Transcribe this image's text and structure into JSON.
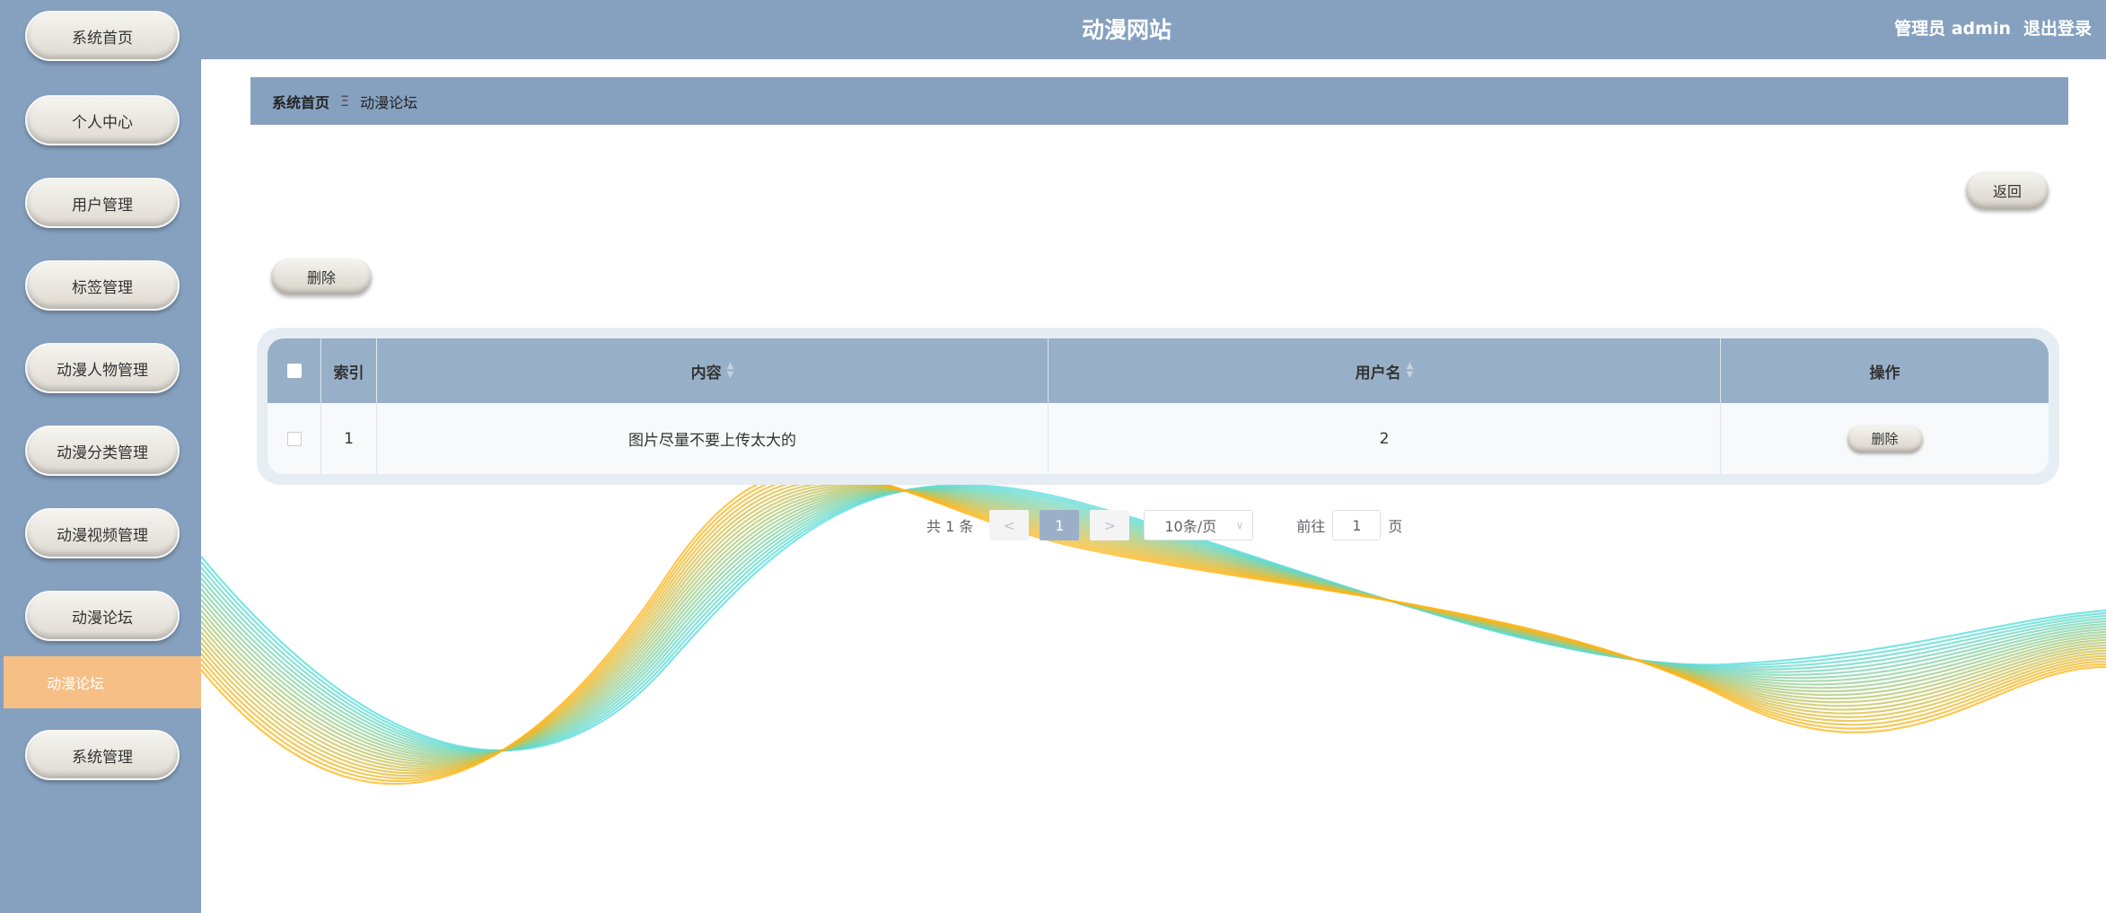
{
  "header": {
    "title": "动漫网站",
    "user_label": "管理员 admin",
    "logout_label": "退出登录"
  },
  "sidebar": {
    "items": [
      {
        "label": "系统首页"
      },
      {
        "label": "个人中心"
      },
      {
        "label": "用户管理"
      },
      {
        "label": "标签管理"
      },
      {
        "label": "动漫人物管理"
      },
      {
        "label": "动漫分类管理"
      },
      {
        "label": "动漫视频管理"
      },
      {
        "label": "动漫论坛"
      },
      {
        "label": "系统管理"
      }
    ],
    "active_sub": "动漫论坛"
  },
  "breadcrumb": {
    "home": "系统首页",
    "separator": "Ξ",
    "current": "动漫论坛"
  },
  "actions": {
    "back_label": "返回",
    "delete_label": "删除"
  },
  "table": {
    "columns": [
      "索引",
      "内容",
      "用户名",
      "操作"
    ],
    "rows": [
      {
        "index": "1",
        "content": "图片尽量不要上传太大的",
        "username": "2",
        "action": "删除"
      }
    ]
  },
  "pagination": {
    "total": "共 1 条",
    "prev": "<",
    "page": "1",
    "next": ">",
    "page_size": "10条/页",
    "goto_label": "前往",
    "goto_value": "1",
    "page_suffix": "页"
  },
  "colors": {
    "primary": "#86a1bf",
    "active": "#f5bf86",
    "table_head": "#98afc8"
  }
}
